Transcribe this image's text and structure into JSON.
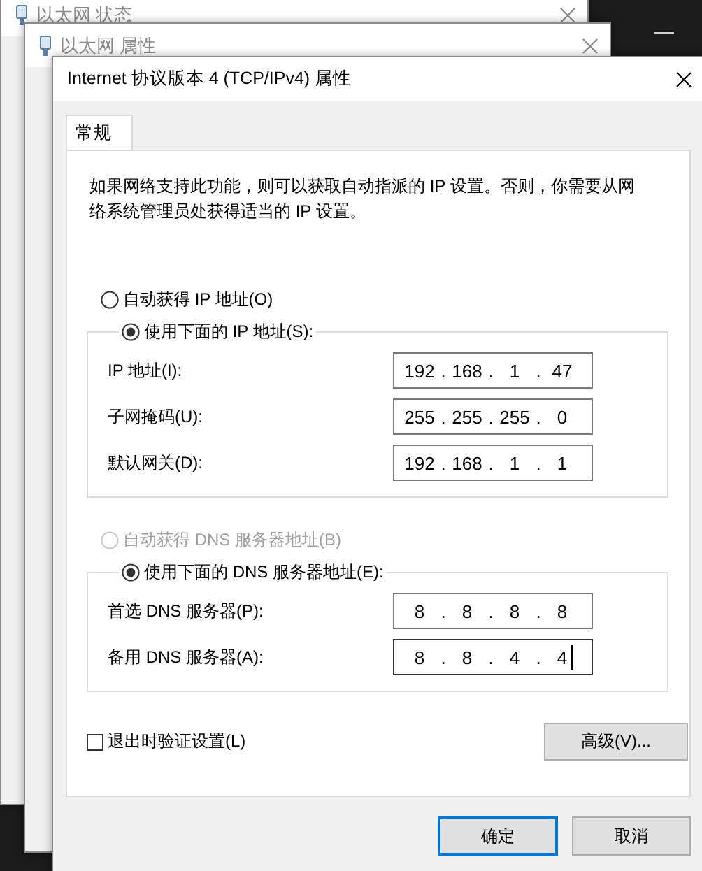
{
  "background_windows": [
    {
      "title": "以太网 状态"
    },
    {
      "title": "以太网 属性"
    }
  ],
  "dialog": {
    "title": "Internet 协议版本 4 (TCP/IPv4) 属性",
    "tabs": [
      {
        "label": "常规",
        "selected": true
      }
    ],
    "description": "如果网络支持此功能，则可以获取自动指派的 IP 设置。否则，你需要从网络系统管理员处获得适当的 IP 设置。",
    "sections": [
      {
        "auto_option": {
          "label": "自动获得 IP 地址(O)",
          "selected": false,
          "disabled": false
        },
        "manual_option": {
          "label": "使用下面的 IP 地址(S):",
          "selected": true,
          "disabled": false
        },
        "fields": [
          {
            "label": "IP 地址(I):",
            "octets": [
              "192",
              "168",
              "1",
              "47"
            ],
            "focused": false
          },
          {
            "label": "子网掩码(U):",
            "octets": [
              "255",
              "255",
              "255",
              "0"
            ],
            "focused": false
          },
          {
            "label": "默认网关(D):",
            "octets": [
              "192",
              "168",
              "1",
              "1"
            ],
            "focused": false
          }
        ]
      },
      {
        "auto_option": {
          "label": "自动获得 DNS 服务器地址(B)",
          "selected": false,
          "disabled": true
        },
        "manual_option": {
          "label": "使用下面的 DNS 服务器地址(E):",
          "selected": true,
          "disabled": false
        },
        "fields": [
          {
            "label": "首选 DNS 服务器(P):",
            "octets": [
              "8",
              "8",
              "8",
              "8"
            ],
            "focused": false
          },
          {
            "label": "备用 DNS 服务器(A):",
            "octets": [
              "8",
              "8",
              "4",
              "4"
            ],
            "focused": true
          }
        ]
      }
    ],
    "separator": ".",
    "validate_checkbox": {
      "label": "退出时验证设置(L)",
      "checked": false
    },
    "advanced_button": "高级(V)...",
    "buttons": [
      {
        "label": "确定",
        "default": true
      },
      {
        "label": "取消",
        "default": false
      }
    ]
  }
}
